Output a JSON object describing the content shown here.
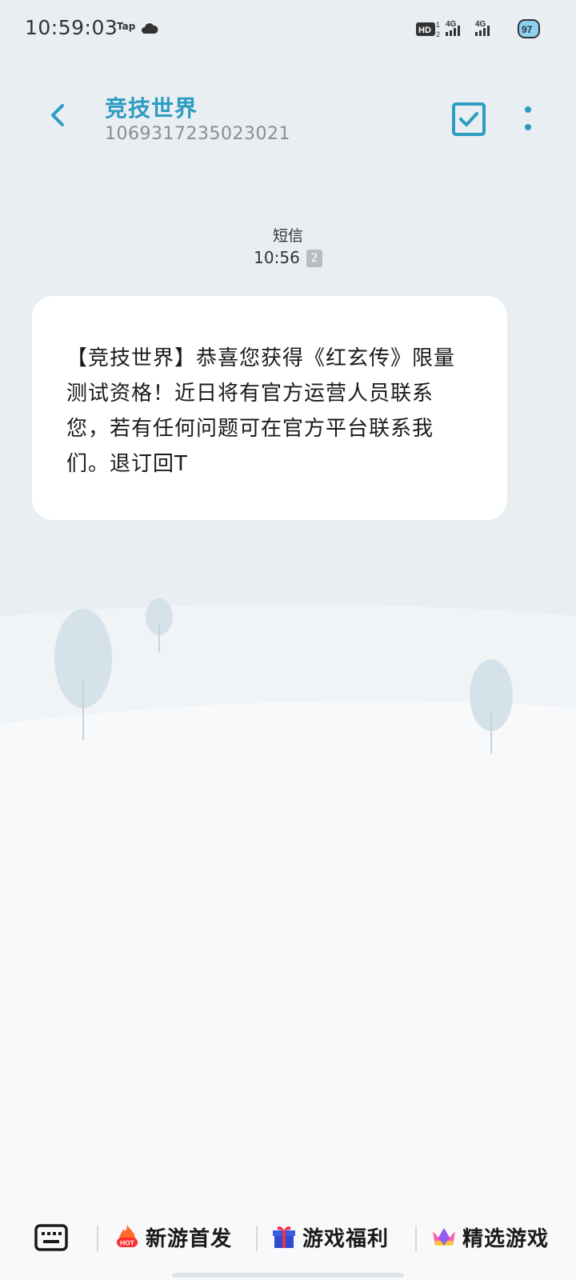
{
  "status_bar": {
    "time": "10:59:03",
    "tap_label": "Tap",
    "network_left": "4G",
    "network_right": "4G",
    "battery": "97",
    "hd_label": "HD"
  },
  "header": {
    "contact_name": "竞技世界",
    "contact_number": "1069317235023021",
    "accent_color": "#2d9cc2"
  },
  "thread": {
    "message_type_label": "短信",
    "time": "10:56",
    "sim_slot": "2"
  },
  "message": {
    "text": "【竞技世界】恭喜您获得《红玄传》限量测试资格！近日将有官方运营人员联系您，若有任何问题可在官方平台联系我们。退订回T"
  },
  "bottom_bar": {
    "tabs": [
      {
        "label": "新游首发",
        "icon": "hot-flame-icon"
      },
      {
        "label": "游戏福利",
        "icon": "gift-icon"
      },
      {
        "label": "精选游戏",
        "icon": "crown-icon"
      }
    ],
    "hot_badge": "HOT"
  }
}
